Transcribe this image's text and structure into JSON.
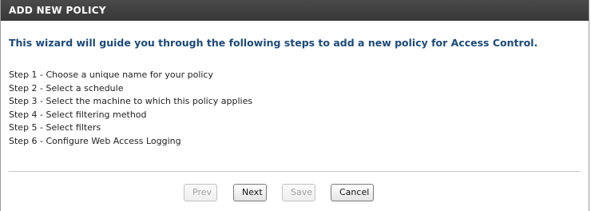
{
  "header": {
    "title": "ADD NEW POLICY"
  },
  "intro": "This wizard will guide you through the following steps to add a new policy for Access Control.",
  "steps": [
    "Step 1 - Choose a unique name for your policy",
    "Step 2 - Select a schedule",
    "Step 3 - Select the machine to which this policy applies",
    "Step 4 - Select filtering method",
    "Step 5 - Select filters",
    "Step 6 - Configure Web Access Logging"
  ],
  "buttons": {
    "prev": "Prev",
    "next": "Next",
    "save": "Save",
    "cancel": "Cancel"
  },
  "colors": {
    "header_bg": "#3f3f3f",
    "intro_text": "#1c4a7a"
  }
}
